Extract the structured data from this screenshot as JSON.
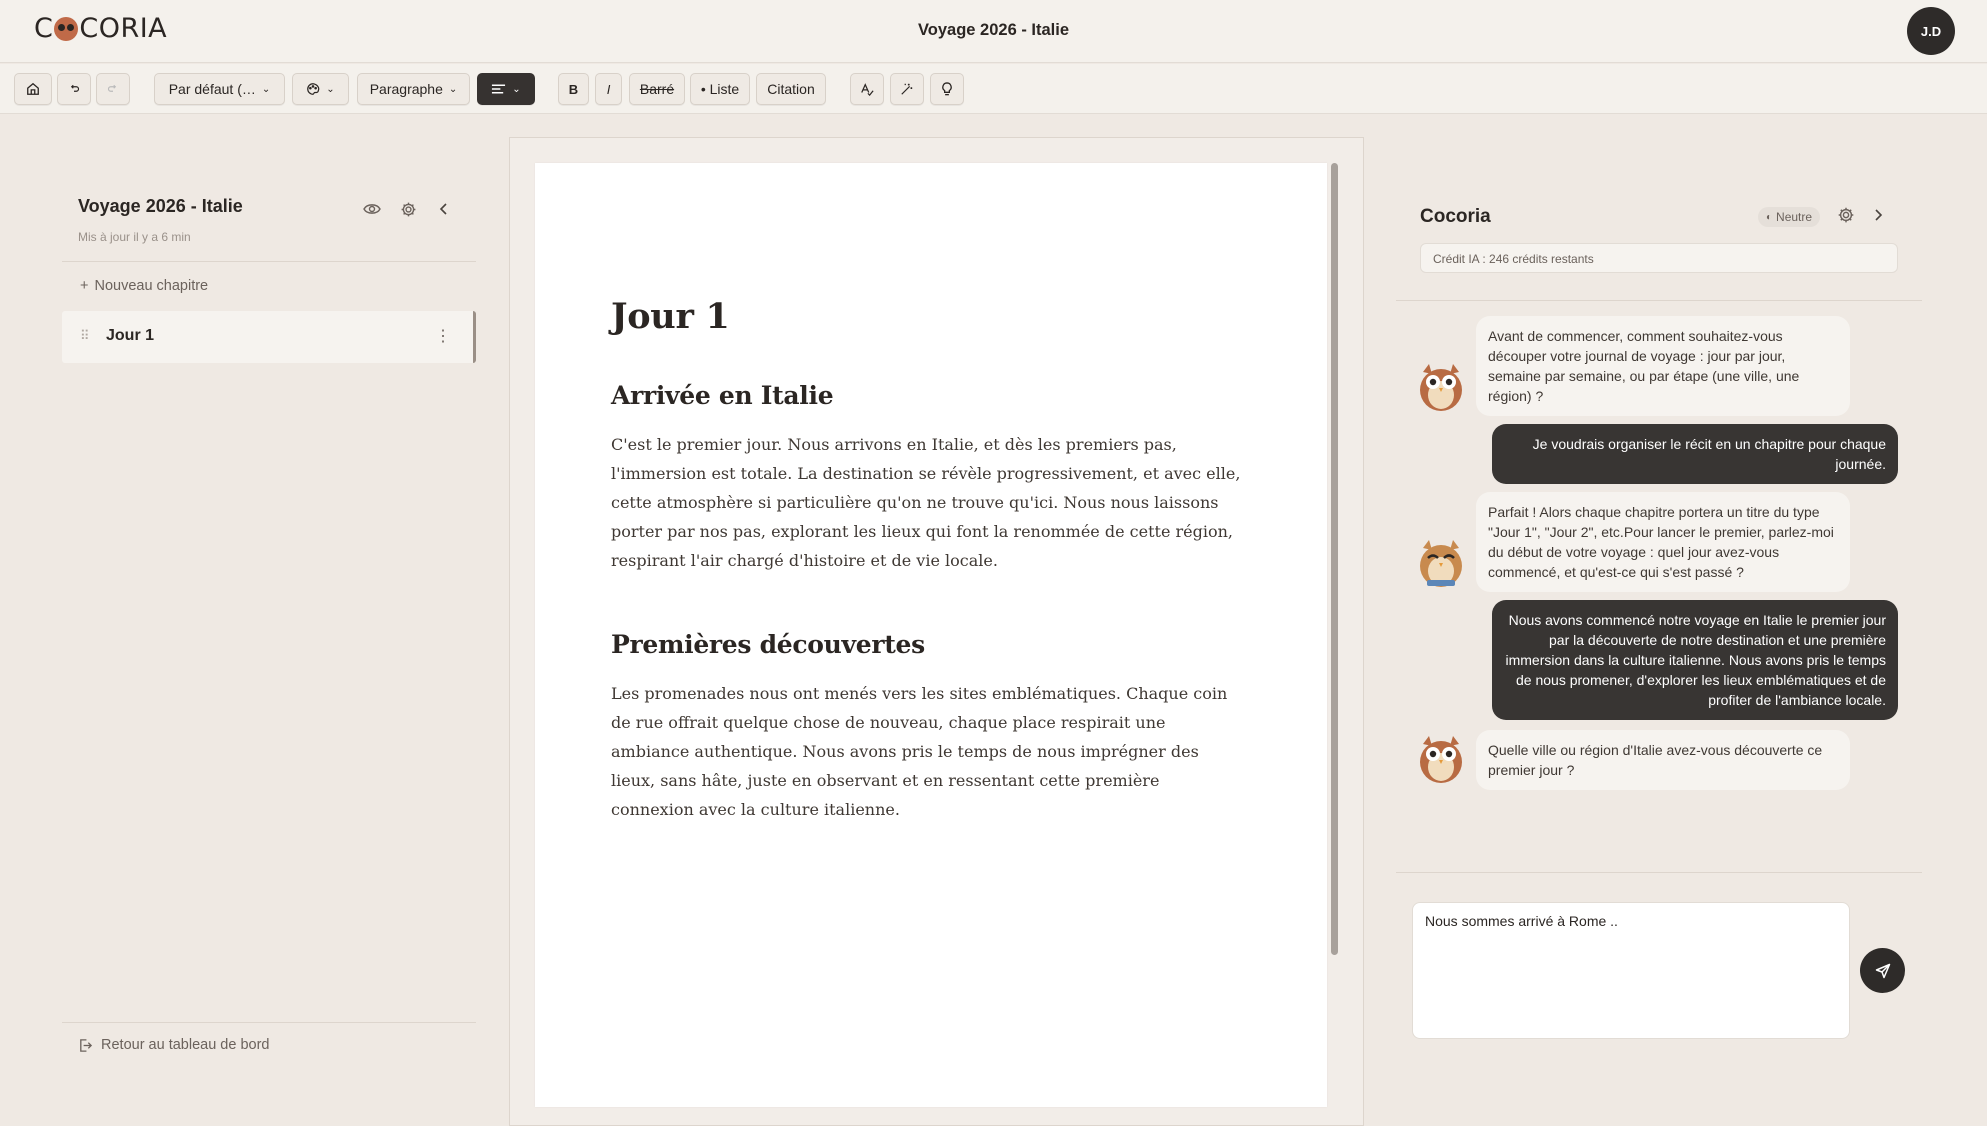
{
  "header": {
    "logo_left": "C",
    "logo_right": "CORIA",
    "title": "Voyage 2026 - Italie",
    "avatar_initials": "J.D"
  },
  "toolbar": {
    "home_icon": "home-icon",
    "undo_icon": "undo-icon",
    "redo_icon": "redo-icon",
    "font_select": "Par défaut (…",
    "palette_icon": "palette-icon",
    "block_select": "Paragraphe",
    "align_icon": "align-left-icon",
    "bold": "B",
    "italic": "I",
    "strike": "Barré",
    "list": "• Liste",
    "quote": "Citation",
    "spellcheck_icon": "spellcheck-icon",
    "magic_icon": "magic-wand-icon",
    "idea_icon": "lightbulb-icon"
  },
  "sidebar": {
    "title": "Voyage 2026 - Italie",
    "updated": "Mis à jour il y a 6 min",
    "new_chapter": "Nouveau chapitre",
    "chapters": [
      {
        "label": "Jour 1",
        "active": true
      }
    ],
    "back": "Retour au tableau de bord"
  },
  "document": {
    "h1": "Jour 1",
    "sections": [
      {
        "heading": "Arrivée en Italie",
        "text": "C'est le premier jour. Nous arrivons en Italie, et dès les premiers pas, l'immersion est totale. La destination se révèle progressivement, et avec elle, cette atmosphère si particulière qu'on ne trouve qu'ici. Nous nous laissons porter par nos pas, explorant les lieux qui font la renommée de cette région, respirant l'air chargé d'histoire et de vie locale."
      },
      {
        "heading": "Premières découvertes",
        "text": "Les promenades nous ont menés vers les sites emblématiques. Chaque coin de rue offrait quelque chose de nouveau, chaque place respirait une ambiance authentique. Nous avons pris le temps de nous imprégner des lieux, sans hâte, juste en observant et en ressentant cette première connexion avec la culture italienne."
      }
    ]
  },
  "chat": {
    "title": "Cocoria",
    "tone": "Neutre",
    "credit": "Crédit IA : 246 crédits restants",
    "messages": [
      {
        "from": "ai",
        "text": "Avant de commencer, comment souhaitez-vous découper votre journal de voyage : jour par jour, semaine par semaine, ou par étape (une ville, une région) ?"
      },
      {
        "from": "me",
        "text": "Je voudrais organiser le récit en un chapitre pour chaque journée."
      },
      {
        "from": "ai",
        "text": "Parfait ! Alors chaque chapitre portera un titre du type \"Jour 1\", \"Jour 2\", etc.Pour lancer le premier, parlez-moi du début de votre voyage : quel jour avez-vous commencé, et qu'est-ce qui s'est passé ?"
      },
      {
        "from": "me",
        "text": "Nous avons commencé notre voyage en Italie le premier jour par la découverte de notre destination et une première immersion dans la culture italienne. Nous avons pris le temps de nous promener, d'explorer les lieux emblématiques et de profiter de l'ambiance locale."
      },
      {
        "from": "ai",
        "text": "Quelle ville ou région d'Italie avez-vous découverte ce premier jour ?"
      }
    ],
    "input_value": "Nous sommes arrivé à Rome ..",
    "send_icon": "send-icon"
  }
}
